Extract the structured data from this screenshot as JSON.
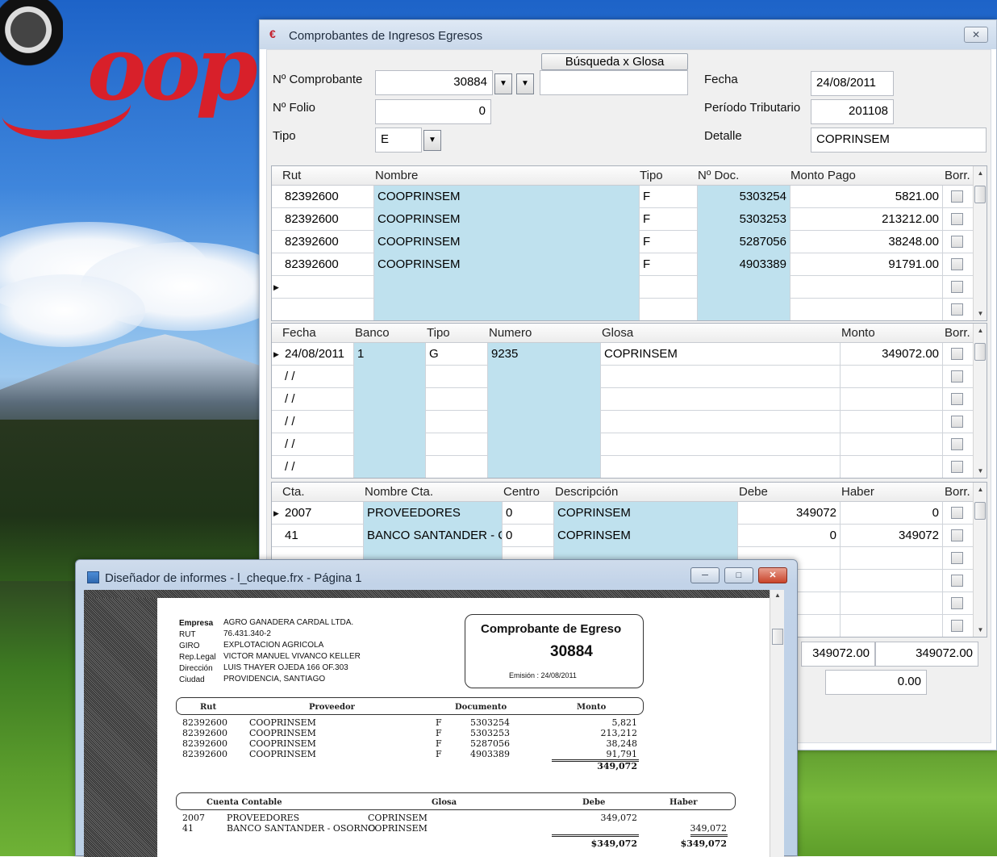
{
  "main_window": {
    "title": "Comprobantes de Ingresos Egresos",
    "close_glyph": "✕"
  },
  "form": {
    "comprobante_label": "Nº Comprobante",
    "comprobante_value": "30884",
    "busqueda_button": "Búsqueda x Glosa",
    "busqueda_value": "",
    "folio_label": "Nº Folio",
    "folio_value": "0",
    "tipo_label": "Tipo",
    "tipo_value": "E",
    "fecha_label": "Fecha",
    "fecha_value": "24/08/2011",
    "periodo_label": "Período Tributario",
    "periodo_value": "201108",
    "detalle_label": "Detalle",
    "detalle_value": "COPRINSEM"
  },
  "grid1": {
    "headers": [
      "Rut",
      "Nombre",
      "Tipo",
      "Nº Doc.",
      "Monto Pago",
      "Borr."
    ],
    "rows": [
      [
        "82392600",
        "COOPRINSEM",
        "F",
        "5303254",
        "5821.00"
      ],
      [
        "82392600",
        "COOPRINSEM",
        "F",
        "5303253",
        "213212.00"
      ],
      [
        "82392600",
        "COOPRINSEM",
        "F",
        "5287056",
        "38248.00"
      ],
      [
        "82392600",
        "COOPRINSEM",
        "F",
        "4903389",
        "91791.00"
      ],
      [
        "",
        "",
        "",
        "",
        ""
      ],
      [
        "",
        "",
        "",
        "",
        ""
      ]
    ]
  },
  "grid2": {
    "headers": [
      "Fecha",
      "Banco",
      "Tipo",
      "Numero",
      "Glosa",
      "Monto",
      "Borr."
    ],
    "rows": [
      [
        "24/08/2011",
        "1",
        "G",
        "9235",
        "COPRINSEM",
        "349072.00"
      ],
      [
        "/ /",
        "",
        "",
        "",
        "",
        ""
      ],
      [
        "/ /",
        "",
        "",
        "",
        "",
        ""
      ],
      [
        "/ /",
        "",
        "",
        "",
        "",
        ""
      ],
      [
        "/ /",
        "",
        "",
        "",
        "",
        ""
      ],
      [
        "/ /",
        "",
        "",
        "",
        "",
        ""
      ]
    ]
  },
  "grid3": {
    "headers": [
      "Cta.",
      "Nombre Cta.",
      "Centro",
      "Descripción",
      "Debe",
      "Haber",
      "Borr."
    ],
    "rows": [
      [
        "2007",
        "PROVEEDORES",
        "0",
        "COPRINSEM",
        "349072",
        "0"
      ],
      [
        "41",
        "BANCO SANTANDER - C",
        "0",
        "COPRINSEM",
        "0",
        "349072"
      ]
    ]
  },
  "totals": {
    "debe_total": "349072.00",
    "haber_total": "349072.00",
    "diferencia": "0.00"
  },
  "report_window": {
    "title": "Diseñador de informes - l_cheque.frx - Página 1"
  },
  "report": {
    "company_labels": [
      "Empresa",
      "RUT",
      "GIRO",
      "Rep.Legal",
      "Dirección",
      "Ciudad"
    ],
    "company_values": [
      "AGRO GANADERA CARDAL LTDA.",
      "76.431.340-2",
      "EXPLOTACION AGRICOLA",
      "VICTOR MANUEL VIVANCO KELLER",
      "LUIS THAYER OJEDA 166 OF.303",
      "PROVIDENCIA, SANTIAGO"
    ],
    "doc_title": "Comprobante de Egreso",
    "doc_number": "30884",
    "emision": "Emisión :  24/08/2011",
    "prov_headers": [
      "Rut",
      "Proveedor",
      "Documento",
      "Monto"
    ],
    "prov_rows": [
      [
        "82392600",
        "COOPRINSEM",
        "F",
        "5303254",
        "5,821"
      ],
      [
        "82392600",
        "COOPRINSEM",
        "F",
        "5303253",
        "213,212"
      ],
      [
        "82392600",
        "COOPRINSEM",
        "F",
        "5287056",
        "38,248"
      ],
      [
        "82392600",
        "COOPRINSEM",
        "F",
        "4903389",
        "91,791"
      ]
    ],
    "prov_total": "349,072",
    "acct_headers": [
      "Cuenta Contable",
      "Glosa",
      "Debe",
      "Haber"
    ],
    "acct_rows": [
      [
        "2007",
        "PROVEEDORES",
        "COPRINSEM",
        "349,072",
        ""
      ],
      [
        "41",
        "BANCO SANTANDER - OSORNO",
        "COPRINSEM",
        "",
        "349,072"
      ]
    ],
    "acct_total_debe": "$349,072",
    "acct_total_haber": "$349,072"
  }
}
